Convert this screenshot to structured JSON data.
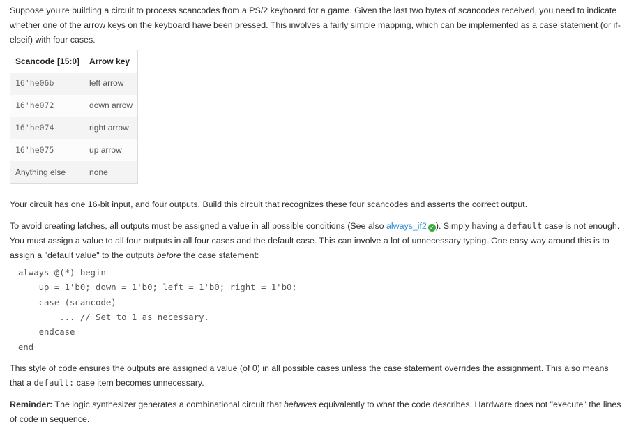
{
  "intro": "Suppose you're building a circuit to process scancodes from a PS/2 keyboard for a game. Given the last two bytes of scancodes received, you need to indicate whether one of the arrow keys on the keyboard have been pressed. This involves a fairly simple mapping, which can be implemented as a case statement (or if-elseif) with four cases.",
  "table": {
    "headers": [
      "Scancode [15:0]",
      "Arrow key"
    ],
    "rows": [
      {
        "code": "16'he06b",
        "key": "left arrow"
      },
      {
        "code": "16'he072",
        "key": "down arrow"
      },
      {
        "code": "16'he074",
        "key": "right arrow"
      },
      {
        "code": "16'he075",
        "key": "up arrow"
      },
      {
        "code": "Anything else",
        "key": "none"
      }
    ]
  },
  "para2": "Your circuit has one 16-bit input, and four outputs. Build this circuit that recognizes these four scancodes and asserts the correct output.",
  "para3": {
    "part1": "To avoid creating latches, all outputs must be assigned a value in all possible conditions (See also ",
    "link": "always_if2",
    "part2": "). Simply having a ",
    "code_default": "default",
    "part3": " case is not enough. You must assign a value to all four outputs in all four cases and the default case. This can involve a lot of unnecessary typing. One easy way around this is to assign a \"default value\" to the outputs ",
    "em_before": "before",
    "part4": " the case statement:"
  },
  "code_lines": [
    "always @(*) begin",
    "    up = 1'b0; down = 1'b0; left = 1'b0; right = 1'b0;",
    "    case (scancode)",
    "        ... // Set to 1 as necessary.",
    "    endcase",
    "end"
  ],
  "para4": {
    "part1": "This style of code ensures the outputs are assigned a value (of 0) in all possible cases unless the case statement overrides the assignment. This also means that a ",
    "code_default": "default:",
    "part2": " case item becomes unnecessary."
  },
  "reminder": {
    "label": "Reminder:",
    "part1": " The logic synthesizer generates a combinational circuit that ",
    "em_behaves": "behaves",
    "part2": " equivalently to what the code describes. Hardware does not \"execute\" the lines of code in sequence."
  }
}
